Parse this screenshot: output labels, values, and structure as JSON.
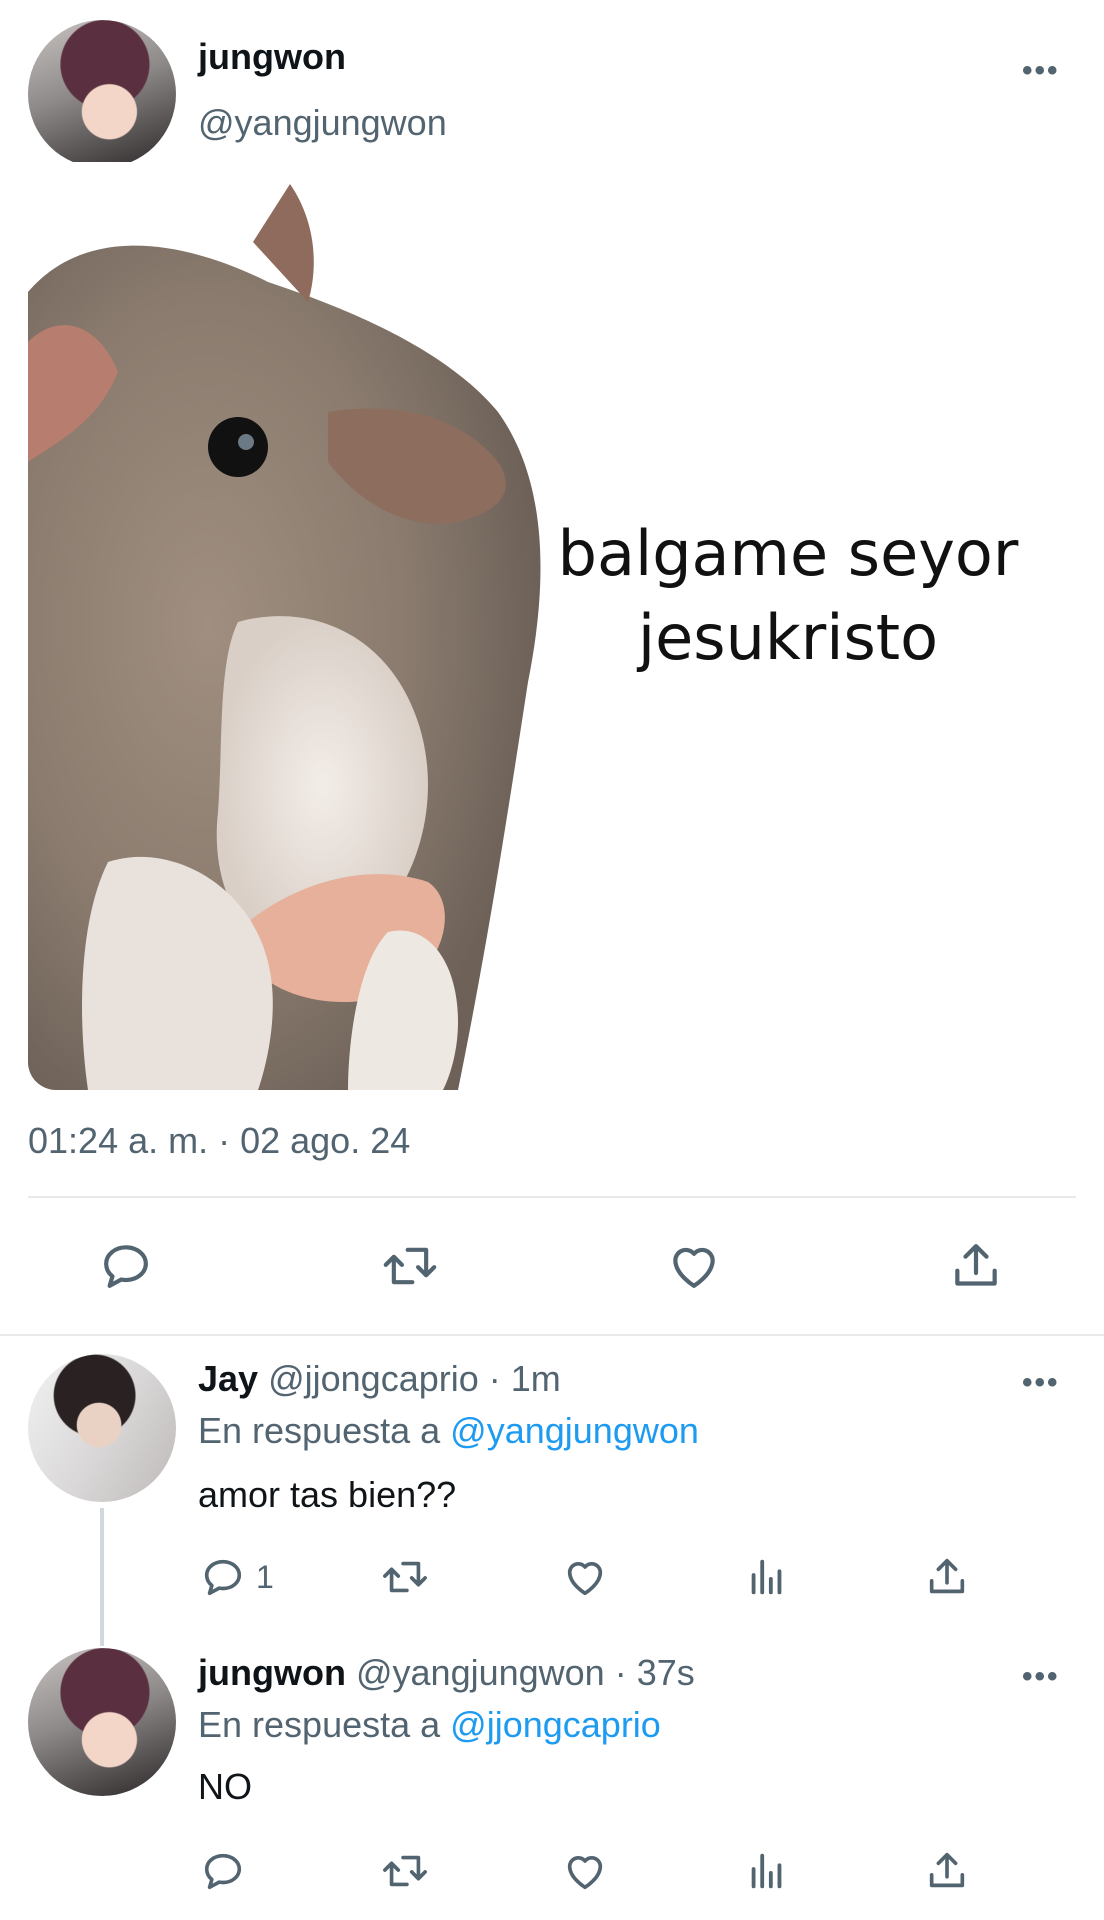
{
  "tweet": {
    "author_name": "jungwon",
    "author_handle": "@yangjungwon",
    "more_label": "•••",
    "image_caption_line1": "balgame seyor",
    "image_caption_line2": "jesukristo",
    "timestamp": "01:24 a. m. · 02 ago. 24"
  },
  "replies": [
    {
      "name": "Jay",
      "handle": "@jjongcaprio",
      "time": "· 1m",
      "reply_prefix": "En respuesta a",
      "reply_to": "@yangjungwon",
      "text": "amor tas bien??",
      "reply_count": "1",
      "more_label": "•••"
    },
    {
      "name": "jungwon",
      "handle": "@yangjungwon",
      "time": "· 37s",
      "reply_prefix": "En respuesta a",
      "reply_to": "@jjongcaprio",
      "text": "NO",
      "more_label": "•••"
    }
  ],
  "colors": {
    "link": "#1d9bf0",
    "secondary_text": "#536471",
    "divider": "#e7e9ea"
  }
}
